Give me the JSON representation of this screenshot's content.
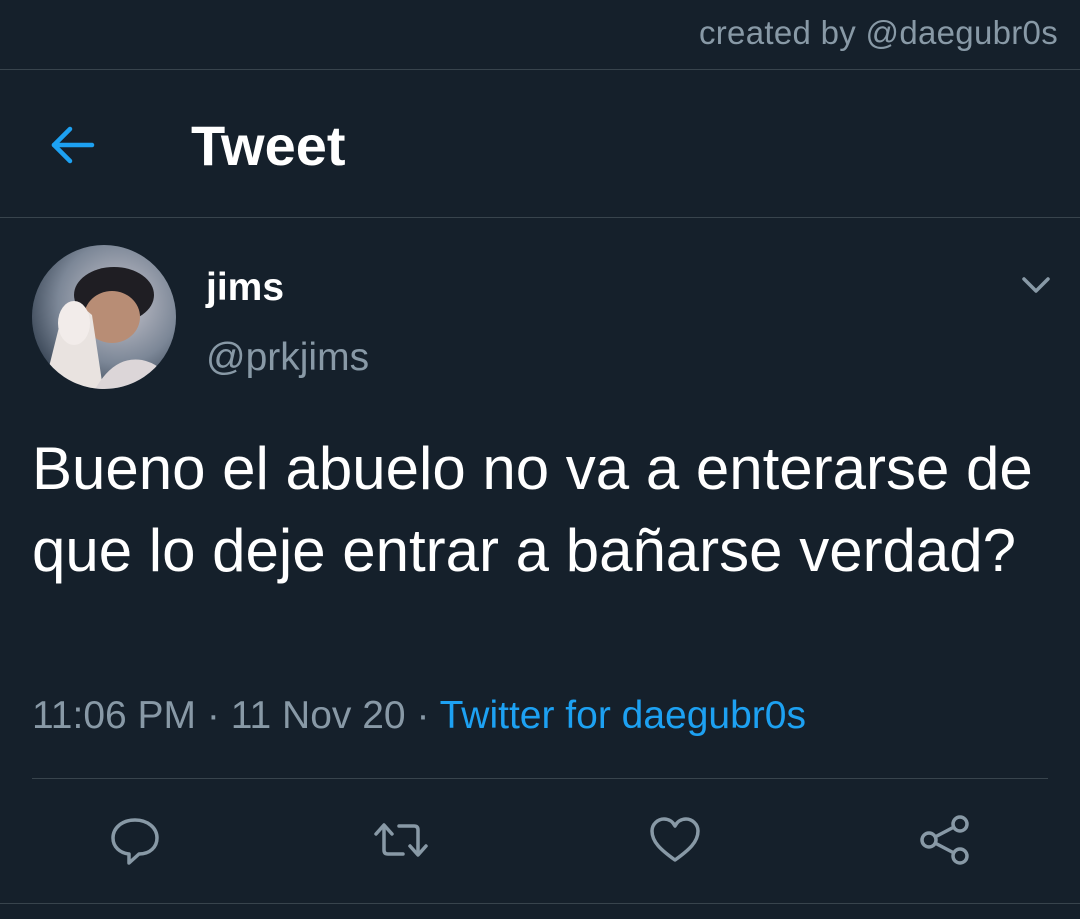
{
  "credit": "created by @daegubr0s",
  "header": {
    "title": "Tweet"
  },
  "tweet": {
    "display_name": "jims",
    "handle": "@prkjims",
    "text": "Bueno el abuelo no va a enterarse de que lo deje entrar a bañarse verdad?",
    "time": "11:06 PM",
    "date": "11 Nov 20",
    "separator": "·",
    "source": "Twitter for daegubr0s"
  },
  "icons": {
    "back": "arrow-left-icon",
    "menu": "chevron-down-icon",
    "reply": "speech-bubble-icon",
    "retweet": "retweet-icon",
    "like": "heart-icon",
    "share": "share-icon"
  },
  "colors": {
    "background": "#15202b",
    "accent": "#1da1f2",
    "muted": "#8899a6",
    "divider": "#38444d",
    "text": "#ffffff"
  }
}
